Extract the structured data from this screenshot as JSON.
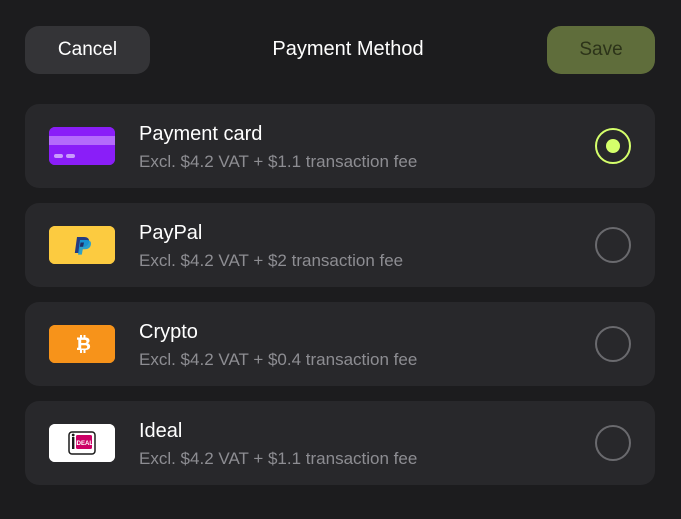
{
  "header": {
    "cancel_label": "Cancel",
    "title": "Payment Method",
    "save_label": "Save"
  },
  "colors": {
    "background": "#1c1c1e",
    "card_background": "#28282b",
    "accent": "#d5ff6b",
    "save_button": "#5f6d3b",
    "muted_text": "#8d8d92"
  },
  "options": [
    {
      "name": "Payment card",
      "description": "Excl. $4.2 VAT + $1.1 transaction fee",
      "icon": "credit-card-icon",
      "selected": true
    },
    {
      "name": "PayPal",
      "description": "Excl. $4.2 VAT + $2 transaction fee",
      "icon": "paypal-icon",
      "selected": false
    },
    {
      "name": "Crypto",
      "description": "Excl. $4.2 VAT + $0.4 transaction fee",
      "icon": "bitcoin-icon",
      "selected": false
    },
    {
      "name": "Ideal",
      "description": "Excl. $4.2 VAT + $1.1 transaction fee",
      "icon": "ideal-icon",
      "icon_text": "iDEAL",
      "selected": false
    }
  ]
}
